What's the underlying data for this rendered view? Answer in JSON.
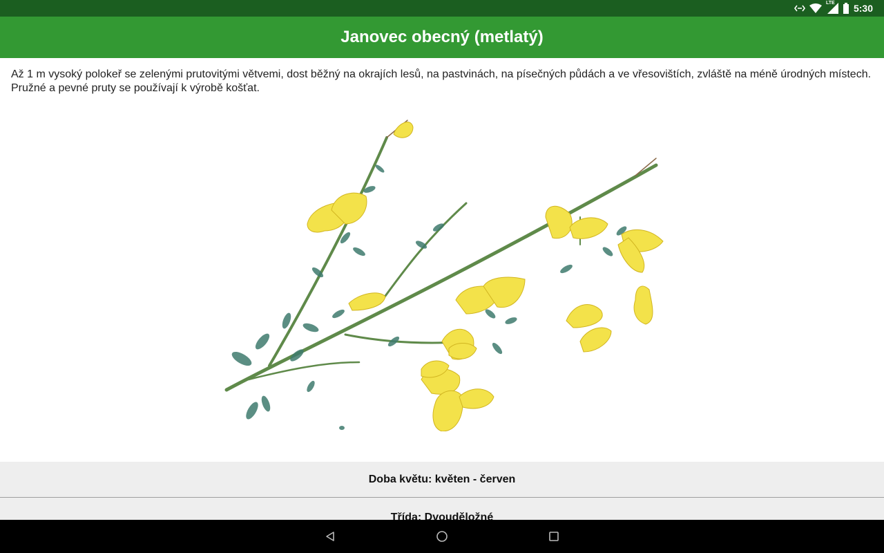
{
  "status_bar": {
    "time": "5:30",
    "network_label": "LTE",
    "icons": [
      "data-transfer-icon",
      "wifi-icon",
      "signal-icon",
      "battery-icon"
    ]
  },
  "app_bar": {
    "title": "Janovec obecný (metlatý)"
  },
  "description": "Až 1 m vysoký polokeř se zelenými prutovitými větvemi, dost běžný na okrajích lesů, na pastvinách, na písečných půdách a ve vřesovištích, zvláště na méně úrodných místech. Pružné a pevné pruty se používají k výrobě košťat.",
  "illustration": {
    "subject": "yellow-flowering-branch"
  },
  "details": {
    "bloom_time": "Doba květu: květen - červen",
    "plant_class": "Třída: Dvouděložné"
  },
  "nav_bar": {
    "buttons": [
      "back-icon",
      "home-icon",
      "recents-icon"
    ]
  },
  "colors": {
    "status_bar": "#1b5e20",
    "app_bar": "#339933",
    "info_bg": "#eeeeee",
    "flower": "#f3e24a",
    "leaf": "#3f7b6e",
    "stem": "#5f8a4a"
  }
}
